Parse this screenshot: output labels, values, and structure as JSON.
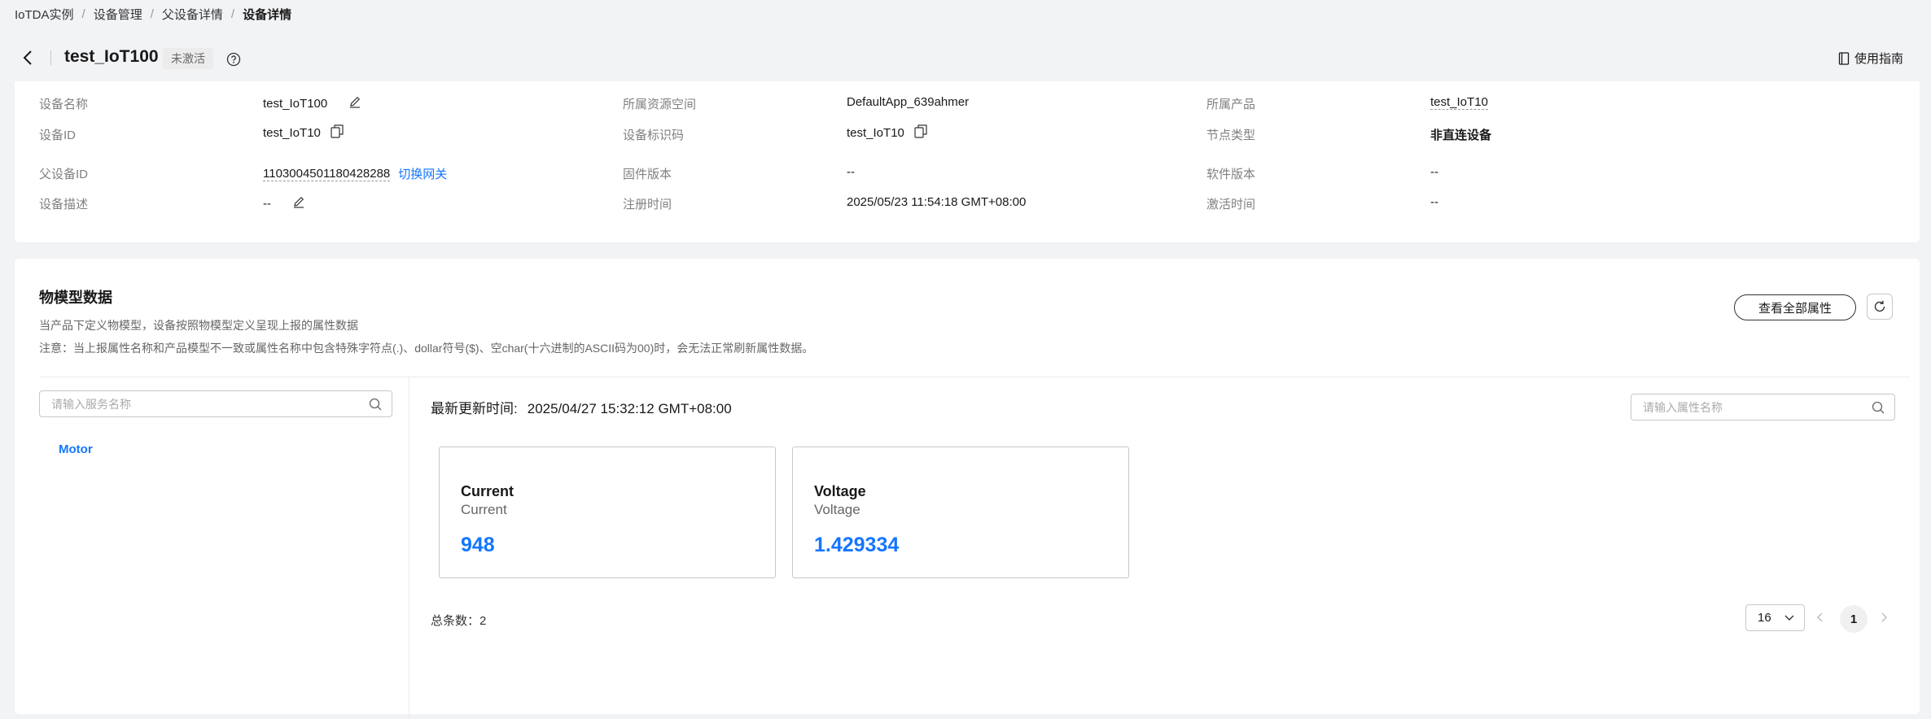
{
  "breadcrumb": {
    "items": [
      "IoTDA实例",
      "设备管理",
      "父设备详情"
    ],
    "current": "设备详情"
  },
  "header": {
    "title": "test_IoT100",
    "status": "未激活",
    "guide": "使用指南"
  },
  "info": {
    "device_name": {
      "label": "设备名称",
      "value": "test_IoT100"
    },
    "resource_space": {
      "label": "所属资源空间",
      "value": "DefaultApp_639ahmer"
    },
    "product": {
      "label": "所属产品",
      "value": "test_IoT10"
    },
    "device_id": {
      "label": "设备ID",
      "value": "test_IoT10"
    },
    "node_id": {
      "label": "设备标识码",
      "value": "test_IoT10"
    },
    "node_type": {
      "label": "节点类型",
      "value": "非直连设备"
    },
    "parent_id": {
      "label": "父设备ID",
      "value": "1103004501180428288",
      "link": "切换网关"
    },
    "firmware": {
      "label": "固件版本",
      "value": "--"
    },
    "software": {
      "label": "软件版本",
      "value": "--"
    },
    "description": {
      "label": "设备描述",
      "value": "--"
    },
    "registered": {
      "label": "注册时间",
      "value": "2025/05/23 11:54:18 GMT+08:00"
    },
    "activated": {
      "label": "激活时间",
      "value": "--"
    }
  },
  "model": {
    "title": "物模型数据",
    "desc1": "当产品下定义物模型，设备按照物模型定义呈现上报的属性数据",
    "desc2": "注意：当上报属性名称和产品模型不一致或属性名称中包含特殊字符点(.)、dollar符号($)、空char(十六进制的ASCII码为00)时，会无法正常刷新属性数据。",
    "view_all": "查看全部属性",
    "service_search_placeholder": "请输入服务名称",
    "property_search_placeholder": "请输入属性名称",
    "services": [
      "Motor"
    ],
    "update_label": "最新更新时间:",
    "update_time": "2025/04/27 15:32:12 GMT+08:00",
    "properties": [
      {
        "name": "Current",
        "id": "Current",
        "value": "948"
      },
      {
        "name": "Voltage",
        "id": "Voltage",
        "value": "1.429334"
      }
    ],
    "total": "总条数：2",
    "page_size": "16",
    "page": "1"
  },
  "colors": {
    "accent": "#1476ff",
    "background": "#f2f3f5",
    "card": "#ffffff"
  }
}
